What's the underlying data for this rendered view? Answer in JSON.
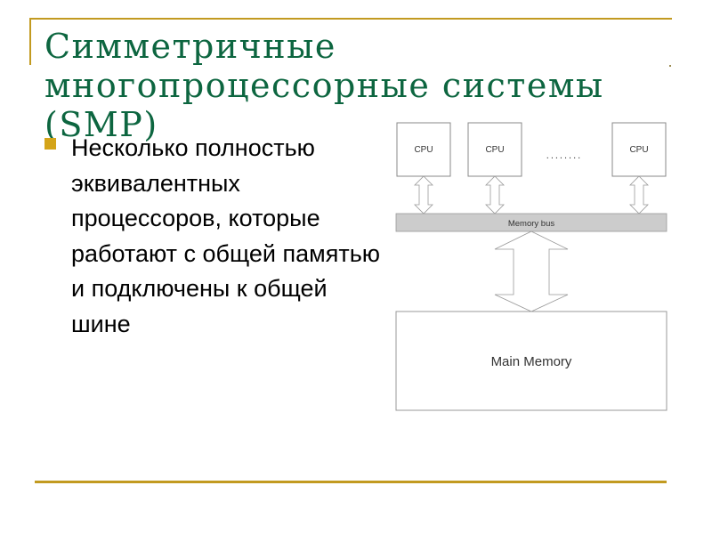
{
  "slide": {
    "title": "Симметричные многопроцессорные системы (SMP)",
    "bullet_text": "Несколько полностью эквивалентных процессоров, которые работают с общей памятью и подключены к общей шине",
    "colors": {
      "title": "#0d6640",
      "accent": "#c29a20",
      "bullet": "#d4a419",
      "bus_fill": "#cccccc"
    }
  },
  "diagram": {
    "cpus": [
      {
        "label": "CPU"
      },
      {
        "label": "CPU"
      },
      {
        "label": "CPU"
      }
    ],
    "ellipsis": "........",
    "bus_label": "Memory bus",
    "memory_label": "Main Memory"
  }
}
